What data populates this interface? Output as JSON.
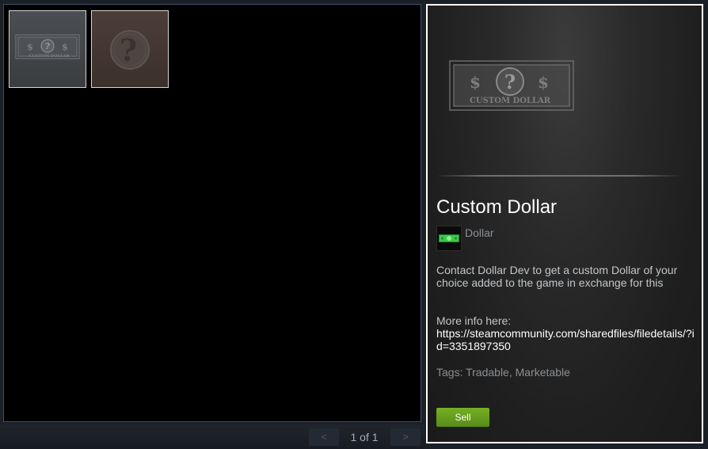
{
  "inventory": {
    "items": [
      {
        "name": "Custom Dollar",
        "icon": "dollar-bill-icon",
        "bg_color": "#45484c",
        "banner": "CUSTOM DOLLAR"
      },
      {
        "name": "Unknown Coin",
        "icon": "question-coin-icon",
        "bg_color": "#463833"
      }
    ]
  },
  "pager": {
    "prev_label": "<",
    "next_label": ">",
    "page_text": "1 of 1"
  },
  "detail": {
    "title": "Custom Dollar",
    "image_banner": "CUSTOM DOLLAR",
    "game_name": "Dollar",
    "game_icon": "green-dollar-bill-icon",
    "description": "Contact Dollar Dev to get a custom Dollar of your choice added to the game in exchange for this",
    "more_info_label": "More info here:",
    "more_info_link": "https://steamcommunity.com/sharedfiles/filedetails/?id=3351897350",
    "tags_label": "Tags:",
    "tags": "Tradable, Marketable",
    "sell_label": "Sell"
  },
  "colors": {
    "accent_green": "#75b022",
    "panel_border": "#ffffff",
    "grid_border": "#3e4d63"
  }
}
